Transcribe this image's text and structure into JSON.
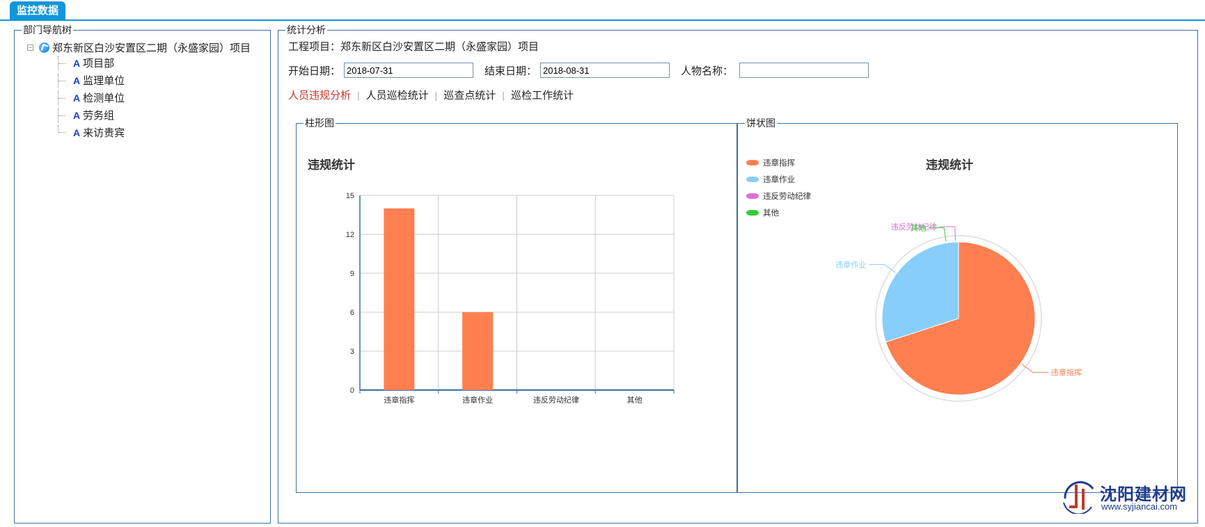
{
  "header": {
    "tab_label": "监控数据"
  },
  "dept_panel": {
    "legend": "部门导航树",
    "root": {
      "label": "郑东新区白沙安置区二期（永盛家园）项目",
      "collapse_symbol": "⊟"
    },
    "items": [
      {
        "label": "项目部"
      },
      {
        "label": "监理单位"
      },
      {
        "label": "检测单位"
      },
      {
        "label": "劳务组"
      },
      {
        "label": "来访贵宾"
      }
    ]
  },
  "stat_panel": {
    "legend": "统计分析",
    "project_label": "工程项目：",
    "project_value": "郑东新区白沙安置区二期（永盛家园）项目",
    "start_label": "开始日期：",
    "start_value": "2018-07-31",
    "end_label": "结束日期：",
    "end_value": "2018-08-31",
    "person_label": "人物名称：",
    "person_value": "",
    "tabs": [
      {
        "label": "人员违规分析",
        "active": true
      },
      {
        "label": "人员巡检统计",
        "active": false
      },
      {
        "label": "巡查点统计",
        "active": false
      },
      {
        "label": "巡检工作统计",
        "active": false
      }
    ],
    "bar_legend": "柱形图",
    "pie_legend": "饼状图"
  },
  "chart_data": [
    {
      "type": "bar",
      "title": "违规统计",
      "categories": [
        "违章指挥",
        "违章作业",
        "违反劳动纪律",
        "其他"
      ],
      "values": [
        14,
        6,
        0,
        0
      ],
      "ylim": [
        0,
        15
      ],
      "yticks": [
        0,
        3,
        6,
        9,
        12,
        15
      ],
      "color": "#ff7f50",
      "grid": true
    },
    {
      "type": "pie",
      "title": "违规统计",
      "labels": [
        "违章指挥",
        "违章作业",
        "违反劳动纪律",
        "其他"
      ],
      "values": [
        14,
        6,
        0,
        0
      ],
      "colors": [
        "#ff7f50",
        "#87cefa",
        "#da70d6",
        "#32cd32"
      ],
      "legend_position": "top-left"
    }
  ],
  "watermark": {
    "name": "沈阳建材网",
    "url": "www.syjiancai.com"
  }
}
